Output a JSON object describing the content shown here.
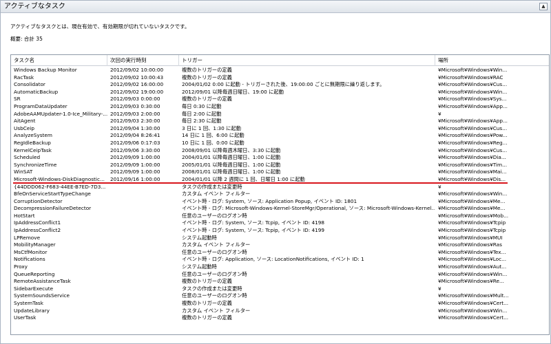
{
  "panel": {
    "title": "アクティブなタスク",
    "collapse_icon": "▲",
    "description": "アクティブなタスクとは、現在有効で、有効期限が切れていないタスクです。",
    "summary": "概要: 合計 35"
  },
  "columns": [
    "タスク名",
    "次回の実行時刻",
    "トリガー",
    "場所"
  ],
  "rows": [
    [
      "Windows Backup Monitor",
      "2012/09/02 10:00:00",
      "複数のトリガーの定義",
      "¥Microsoft¥Windows¥Win..."
    ],
    [
      "RacTask",
      "2012/09/02 10:00:43",
      "複数のトリガーの定義",
      "¥Microsoft¥Windows¥RAC"
    ],
    [
      "Consolidator",
      "2012/09/02 16:00:00",
      "2004/01/02 0:00 に起動 - トリガーされた後、19:00:00 ごとに無期限に繰り返します。",
      "¥Microsoft¥Windows¥Cus..."
    ],
    [
      "AutomaticBackup",
      "2012/09/02 19:00:00",
      "2012/09/01 以降毎週日曜日、19:00 に起動",
      "¥Microsoft¥Windows¥Win..."
    ],
    [
      "SR",
      "2012/09/03 0:00:00",
      "複数のトリガーの定義",
      "¥Microsoft¥Windows¥Sys..."
    ],
    [
      "ProgramDataUpdater",
      "2012/09/03 0:30:00",
      "毎日 0:30 に起動",
      "¥Microsoft¥Windows¥App..."
    ],
    [
      "AdobeAAMUpdater-1.0-Ice_Military-...",
      "2012/09/03 2:00:00",
      "毎日 2:00 に起動",
      "¥"
    ],
    [
      "AitAgent",
      "2012/09/03 2:30:00",
      "毎日 2:30 に起動",
      "¥Microsoft¥Windows¥App..."
    ],
    [
      "UsbCeip",
      "2012/09/04 1:30:00",
      "3 日に 1 回、1:30 に起動",
      "¥Microsoft¥Windows¥Cus..."
    ],
    [
      "AnalyzeSystem",
      "2012/09/04 8:26:41",
      "14 日に 1 回、6:00 に起動",
      "¥Microsoft¥Windows¥Pow..."
    ],
    [
      "RegIdleBackup",
      "2012/09/06 0:17:03",
      "10 日に 1 回、0:00 に起動",
      "¥Microsoft¥Windows¥Reg..."
    ],
    [
      "KernelCeipTask",
      "2012/09/06 3:30:00",
      "2008/09/01 以降毎週木曜日、3:30 に起動",
      "¥Microsoft¥Windows¥Cus..."
    ],
    [
      "Scheduled",
      "2012/09/09 1:00:00",
      "2004/01/01 以降毎週日曜日、1:00 に起動",
      "¥Microsoft¥Windows¥Dia..."
    ],
    [
      "SynchronizeTime",
      "2012/09/09 1:00:00",
      "2005/01/01 以降毎週日曜日、1:00 に起動",
      "¥Microsoft¥Windows¥Tim..."
    ],
    [
      "WinSAT",
      "2012/09/09 1:00:00",
      "2008/01/01 以降毎週日曜日、1:00 に起動",
      "¥Microsoft¥Windows¥Mai..."
    ],
    [
      "Microsoft-Windows-DiskDiagnostic...",
      "2012/09/16 1:00:00",
      "2004/01/01 以降 2 週間に 1 回、日曜日 1:00 に起動",
      "¥Microsoft¥Windows¥Dis..."
    ],
    [
      "{44DDD062-F683-44EE-B7ED-7D3...",
      "",
      "タスクの作成または変更時",
      "¥"
    ],
    [
      "BfeOnServiceStartTypeChange",
      "",
      "カスタム イベント フィルター",
      "¥Microsoft¥Windows¥Win..."
    ],
    [
      "CorruptionDetector",
      "",
      "イベント時 - ログ: System, ソース: Application Popup, イベント ID: 1801",
      "¥Microsoft¥Windows¥Me..."
    ],
    [
      "DecompressionFailureDetector",
      "",
      "イベント時 - ログ: Microsoft-Windows-Kernel-StoreMgr/Operational, ソース: Microsoft-Windows-Kernel...",
      "¥Microsoft¥Windows¥Me..."
    ],
    [
      "HotStart",
      "",
      "任意のユーザーのログオン時",
      "¥Microsoft¥Windows¥Mob..."
    ],
    [
      "IpAddressConflict1",
      "",
      "イベント時 - ログ: System, ソース: Tcpip, イベント ID: 4198",
      "¥Microsoft¥Windows¥Tcpip"
    ],
    [
      "IpAddressConflict2",
      "",
      "イベント時 - ログ: System, ソース: Tcpip, イベント ID: 4199",
      "¥Microsoft¥Windows¥Tcpip"
    ],
    [
      "LPRemove",
      "",
      "システム起動時",
      "¥Microsoft¥Windows¥MUI"
    ],
    [
      "MobilityManager",
      "",
      "カスタム イベント フィルター",
      "¥Microsoft¥Windows¥Ras"
    ],
    [
      "MsCtfMonitor",
      "",
      "任意のユーザーのログオン時",
      "¥Microsoft¥Windows¥Tex..."
    ],
    [
      "Notifications",
      "",
      "イベント時 - ログ: Application, ソース: LocationNotifications, イベント ID: 1",
      "¥Microsoft¥Windows¥Loc..."
    ],
    [
      "Proxy",
      "",
      "システム起動時",
      "¥Microsoft¥Windows¥Aut..."
    ],
    [
      "QueueReporting",
      "",
      "任意のユーザーのログオン時",
      "¥Microsoft¥Windows¥Win..."
    ],
    [
      "RemoteAssistanceTask",
      "",
      "複数のトリガーの定義",
      "¥Microsoft¥Windows¥Re..."
    ],
    [
      "SidebarExecute",
      "",
      "タスクの作成または変更時",
      "¥"
    ],
    [
      "SystemSoundsService",
      "",
      "任意のユーザーのログオン時",
      "¥Microsoft¥Windows¥Mult..."
    ],
    [
      "SystemTask",
      "",
      "複数のトリガーの定義",
      "¥Microsoft¥Windows¥Cert..."
    ],
    [
      "UpdateLibrary",
      "",
      "カスタム イベント フィルター",
      "¥Microsoft¥Windows¥Win..."
    ],
    [
      "UserTask",
      "",
      "複数のトリガーの定義",
      "¥Microsoft¥Windows¥Cert..."
    ]
  ],
  "highlight_color": "#d8141b"
}
